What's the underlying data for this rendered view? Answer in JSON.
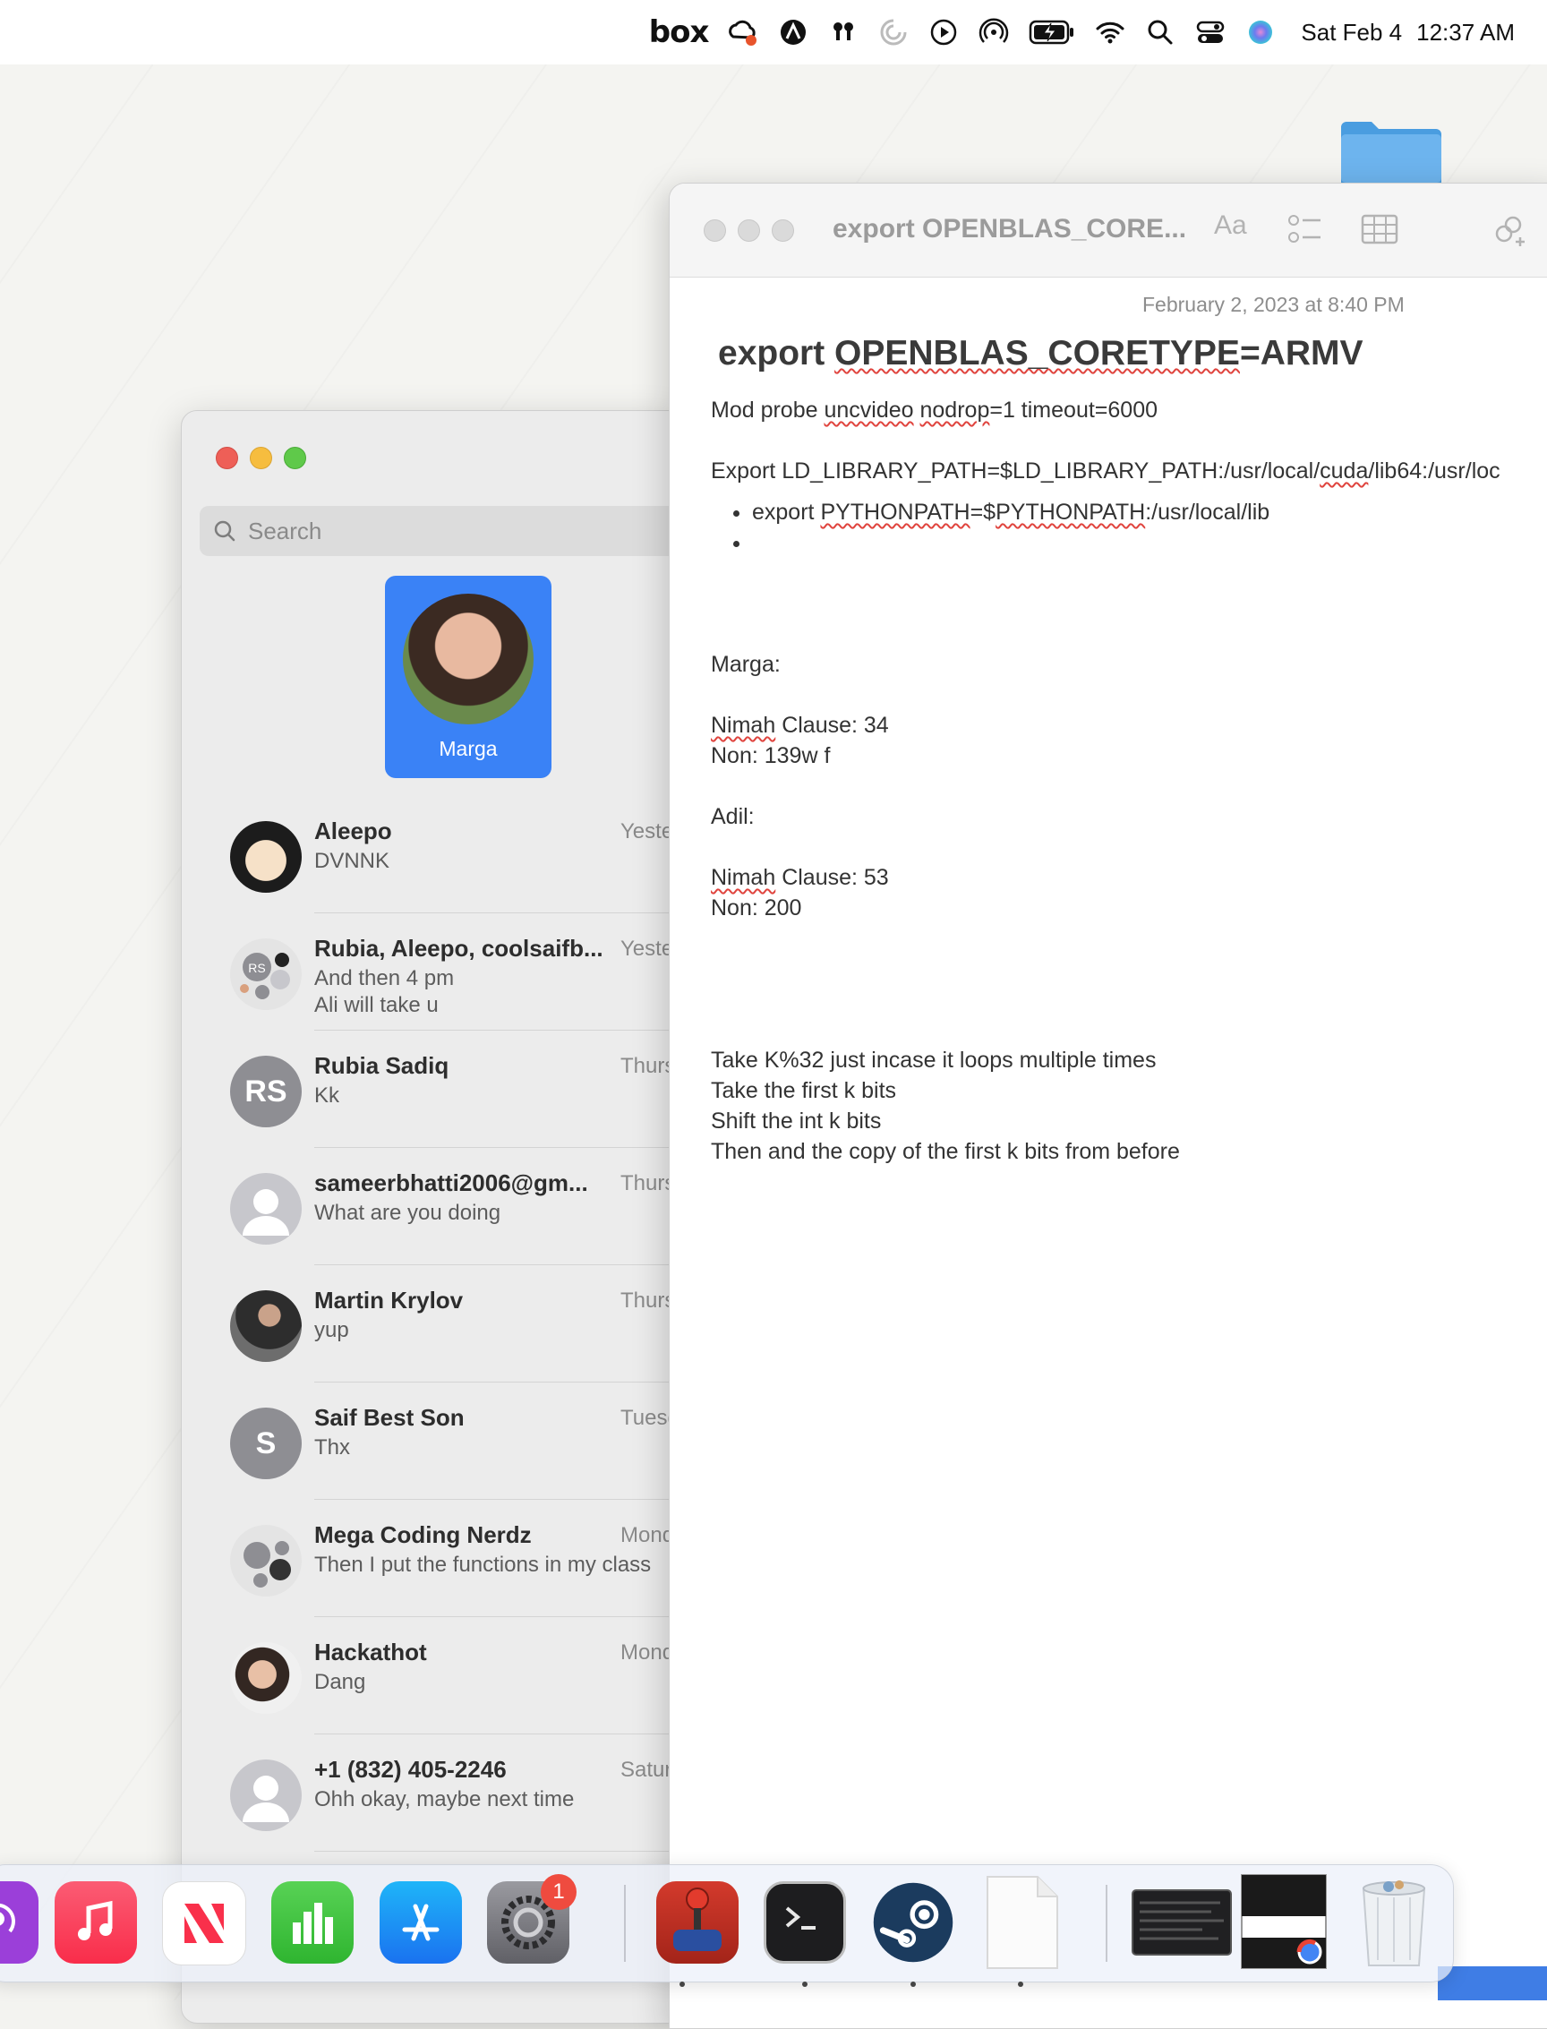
{
  "menubar": {
    "date": "Sat Feb 4",
    "time": "12:37 AM",
    "items": [
      "box-icon",
      "creative-cloud-icon",
      "alfred-icon",
      "airpods-icon",
      "loading-icon",
      "play-icon",
      "airdrop-icon",
      "battery-icon",
      "wifi-icon",
      "spotlight-icon",
      "control-center-icon",
      "siri-icon"
    ],
    "box_label": "box"
  },
  "messages": {
    "search_placeholder": "Search",
    "pinned": {
      "name": "Marga"
    },
    "chats": [
      {
        "name": "Aleepo",
        "time": "Yesterday",
        "preview": "DVNNK",
        "avatar": "photo1"
      },
      {
        "name": "Rubia, Aleepo, coolsaifb...",
        "time": "Yesterday",
        "preview": "And then 4 pm\nAli will take u",
        "avatar": "group"
      },
      {
        "name": "Rubia Sadiq",
        "time": "Thursday",
        "preview": "Kk",
        "avatar": "initials",
        "initials": "RS"
      },
      {
        "name": "sameerbhatti2006@gm...",
        "time": "Thursday",
        "preview": "What are you doing",
        "avatar": "person"
      },
      {
        "name": "Martin Krylov",
        "time": "Thursday",
        "preview": "yup",
        "avatar": "photo2"
      },
      {
        "name": "Saif Best Son",
        "time": "Tuesday",
        "preview": "Thx",
        "avatar": "initials",
        "initials": "S"
      },
      {
        "name": "Mega Coding Nerdz",
        "time": "Monday",
        "preview": "Then I put the functions in my class",
        "avatar": "group"
      },
      {
        "name": "Hackathot",
        "time": "Monday",
        "preview": "Dang",
        "avatar": "photo3"
      },
      {
        "name": "+1 (832) 405-2246",
        "time": "Saturday",
        "preview": "Ohh okay, maybe next time",
        "avatar": "person"
      }
    ]
  },
  "notes": {
    "window_title": "export OPENBLAS_CORE...",
    "font_button": "Aa",
    "date": "February 2, 2023 at 8:40 PM",
    "heading": {
      "a": "export ",
      "b": "OPENBLAS_CORETYPE",
      "c": "=ARMV"
    },
    "line1": {
      "a": "Mod probe ",
      "b": "uncvideo",
      "c": " ",
      "d": "nodrop",
      "e": "=1 timeout=6000"
    },
    "line2": {
      "a": "Export LD_LIBRARY_PATH=$LD_LIBRARY_PATH:/usr/local/",
      "b": "cuda",
      "c": "/lib64:/usr/loc"
    },
    "bullet1": {
      "a": "export ",
      "b": "PYTHONPATH",
      "c": "=$",
      "d": "PYTHONPATH",
      "e": ":/usr/local/lib"
    },
    "marga": "Marga:",
    "marga_nimah": {
      "a": "Nimah",
      "b": " Clause: 34"
    },
    "marga_non": "Non: 139w f",
    "adil": "Adil:",
    "adil_nimah": {
      "a": "Nimah",
      "b": " Clause: 53"
    },
    "adil_non": "Non: 200",
    "steps": [
      "Take K%32 just incase it loops multiple times",
      "Take the first k bits",
      "Shift the int k bits",
      "Then and the copy of the first k bits from before"
    ]
  },
  "dock": {
    "apps": [
      "podcasts-icon",
      "music-icon",
      "news-icon",
      "numbers-icon",
      "app-store-icon",
      "system-settings-icon",
      "joystick-app-icon",
      "terminal-icon",
      "steam-icon",
      "document-icon",
      "window-preview-icon",
      "chrome-window-icon",
      "trash-icon"
    ],
    "settings_badge": "1"
  },
  "colors": {
    "accent_blue": "#3a82f6",
    "close_red": "#ee5f57",
    "minimize_yellow": "#f6bd3f",
    "zoom_green": "#5fc94a",
    "spell_red": "#e0443e"
  }
}
